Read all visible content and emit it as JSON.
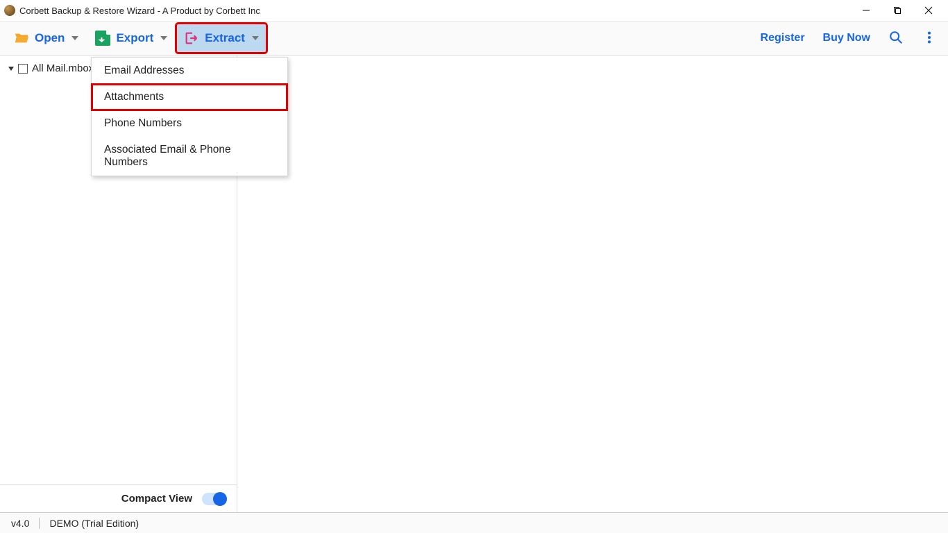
{
  "window": {
    "title": "Corbett Backup & Restore Wizard - A Product by Corbett Inc"
  },
  "toolbar": {
    "open_label": "Open",
    "export_label": "Export",
    "extract_label": "Extract",
    "register_label": "Register",
    "buynow_label": "Buy Now"
  },
  "extract_menu": {
    "items": [
      {
        "label": "Email Addresses"
      },
      {
        "label": "Attachments"
      },
      {
        "label": "Phone Numbers"
      },
      {
        "label": "Associated Email & Phone Numbers"
      }
    ]
  },
  "sidebar": {
    "tree": {
      "root_label": "All Mail.mbox"
    },
    "compact_label": "Compact View"
  },
  "statusbar": {
    "version": "v4.0",
    "edition": "DEMO (Trial Edition)"
  }
}
